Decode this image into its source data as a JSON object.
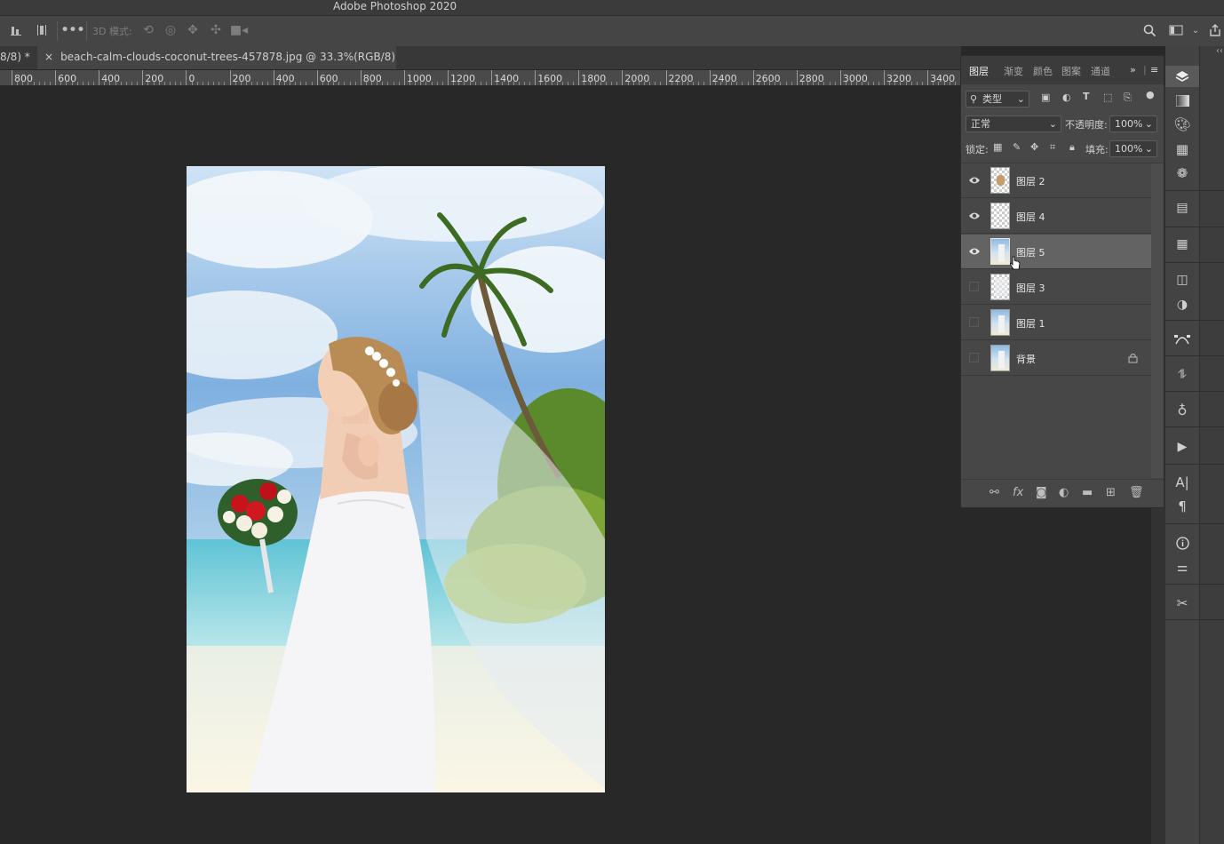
{
  "app": {
    "window_title": "Adobe Photoshop 2020"
  },
  "options_bar": {
    "mode_label": "3D 模式:",
    "icons": [
      "align-bottom-icon",
      "distribute-icon",
      "more-icon",
      "orbit-3d-icon",
      "roll-3d-icon",
      "pan-3d-icon",
      "slide-3d-icon",
      "scale-3d-icon"
    ],
    "right_icons": [
      "search-icon",
      "workspace-icon",
      "share-icon"
    ]
  },
  "tabs": [
    {
      "label": "8/8) *"
    },
    {
      "label": "beach-calm-clouds-coconut-trees-457878.jpg @ 33.3%(RGB/8)",
      "close": "×"
    }
  ],
  "ruler": {
    "labels": [
      "800",
      "600",
      "400",
      "200",
      "0",
      "200",
      "400",
      "600",
      "800",
      "1000",
      "1200",
      "1400",
      "1600",
      "1800",
      "2000",
      "2200",
      "2400",
      "2600",
      "2800",
      "3000",
      "3200",
      "3400"
    ]
  },
  "layers_panel": {
    "tabs": [
      "图层",
      "渐变",
      "颜色",
      "图案",
      "通道"
    ],
    "active_tab": "图层",
    "filter_label": "类型",
    "blend_mode": "正常",
    "opacity_label": "不透明度:",
    "opacity_value": "100%",
    "lock_label": "锁定:",
    "fill_label": "填充:",
    "fill_value": "100%",
    "layers": [
      {
        "name": "图层 2",
        "visible": true,
        "selected": false,
        "locked": false
      },
      {
        "name": "图层 4",
        "visible": true,
        "selected": false,
        "locked": false
      },
      {
        "name": "图层 5",
        "visible": true,
        "selected": true,
        "locked": false
      },
      {
        "name": "图层 3",
        "visible": false,
        "selected": false,
        "locked": false
      },
      {
        "name": "图层 1",
        "visible": false,
        "selected": false,
        "locked": false
      },
      {
        "name": "背景",
        "visible": false,
        "selected": false,
        "locked": true
      }
    ],
    "bottom_icons": [
      "link-icon",
      "fx-icon",
      "mask-icon",
      "adjustment-icon",
      "folder-icon",
      "new-layer-icon",
      "trash-icon"
    ]
  },
  "right_strip": {
    "icons": [
      "layers-icon",
      "gradient-icon",
      "color-icon",
      "swatches-icon",
      "channels-icon",
      "properties-icon",
      "table-icon",
      "library-icon",
      "adjustments-icon",
      "paths-icon",
      "brush-settings-icon",
      "light-icon",
      "actions-icon",
      "character-icon",
      "paragraph-icon",
      "info-icon",
      "sliders-icon",
      "tools-icon"
    ]
  }
}
